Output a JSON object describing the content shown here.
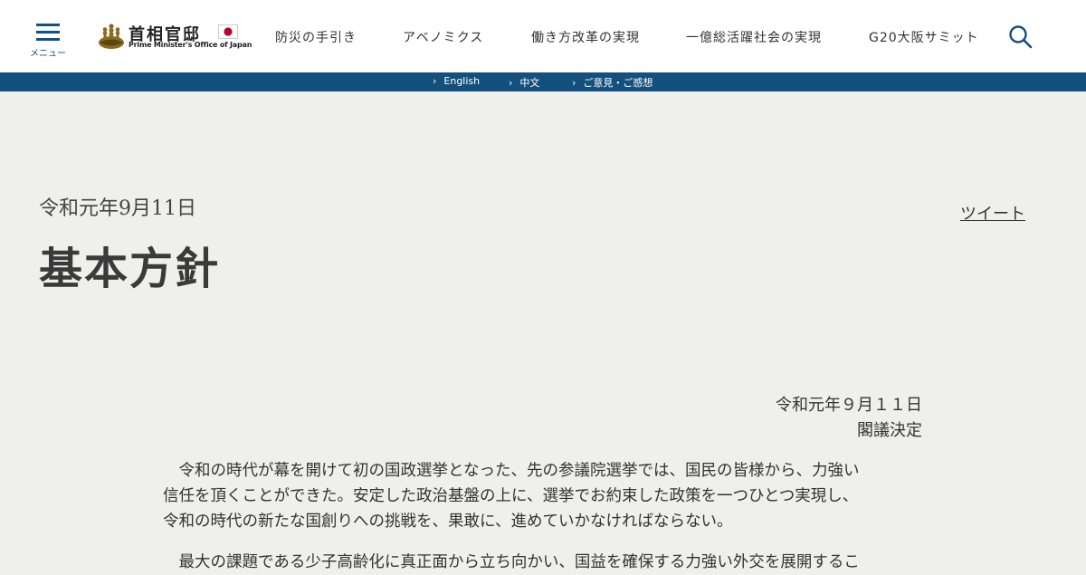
{
  "header": {
    "menu_label": "メニュー",
    "logo_jp": "首相官邸",
    "logo_en": "Prime Minister's Office of Japan",
    "nav": [
      "防災の手引き",
      "アベノミクス",
      "働き方改革の実現",
      "一億総活躍社会の実現",
      "G20大阪サミット"
    ],
    "search_icon": "search-icon"
  },
  "langbar": {
    "links": [
      "English",
      "中文",
      "ご意見・ご感想"
    ]
  },
  "main": {
    "date": "令和元年9月11日",
    "title": "基本方針",
    "tweet": "ツイート",
    "decision_date": "令和元年９月１１日",
    "decision_label": "閣議決定",
    "paragraph1": [
      "　令和の時代が幕を開けて初の国政選挙となった、先の参議院選挙では、国民の皆様から、力強い",
      "信任を頂くことができた。安定した政治基盤の上に、選挙でお約束した政策を一つひとつ実現し、",
      "令和の時代の新たな国創りへの挑戦を、果敢に、進めていかなければならない。"
    ],
    "paragraph2": [
      "　最大の課題である少子高齢化に真正面から立ち向かい、国益を確保する力強い外交を展開するこ"
    ]
  },
  "colors": {
    "brand_blue": "#14507d",
    "background": "#efefed",
    "header_bg": "#ffffff",
    "flag_red": "#bc002d"
  }
}
